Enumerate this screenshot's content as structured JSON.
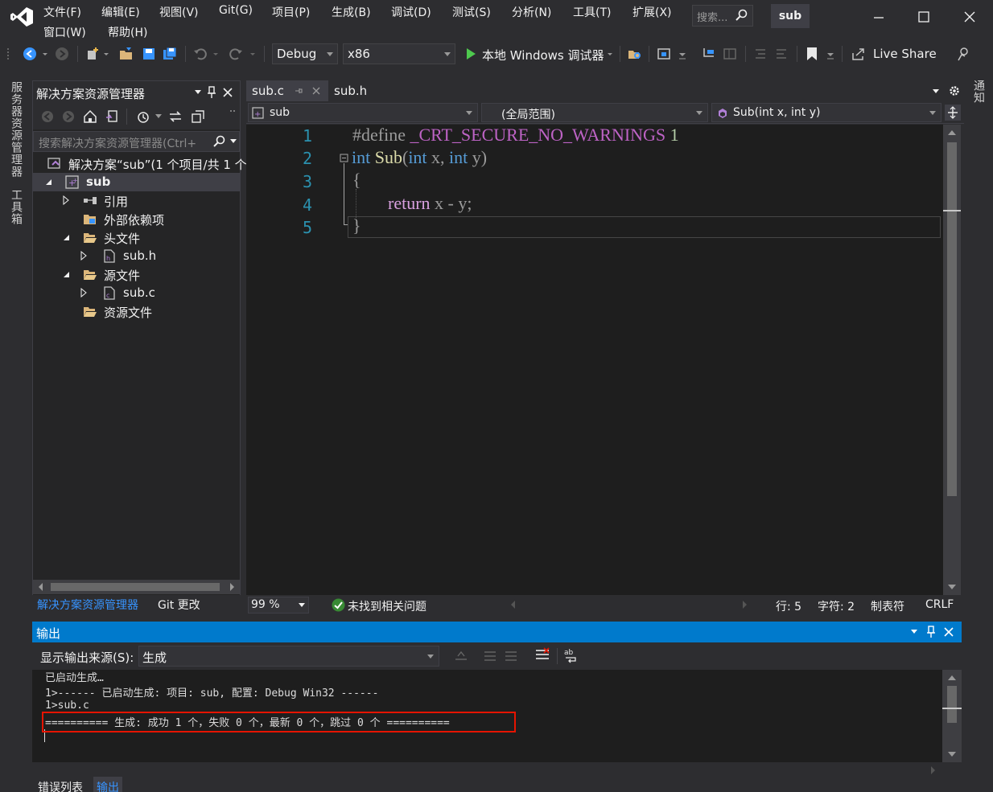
{
  "menu": {
    "items": [
      "文件(F)",
      "编辑(E)",
      "视图(V)",
      "Git(G)",
      "项目(P)",
      "生成(B)",
      "调试(D)",
      "测试(S)",
      "分析(N)",
      "工具(T)",
      "扩展(X)"
    ],
    "row2": [
      "窗口(W)",
      "帮助(H)"
    ],
    "search_placeholder": "搜索...",
    "solution_name": "sub"
  },
  "toolbar": {
    "config": "Debug",
    "platform": "x86",
    "run_label": "本地 Windows 调试器",
    "live_share": "Live Share"
  },
  "left_vtabs": [
    "服务器资源管理器",
    "工具箱"
  ],
  "right_vtab": "通知",
  "solution_explorer": {
    "title": "解决方案资源管理器",
    "search_placeholder": "搜索解决方案资源管理器(Ctrl+",
    "tree": [
      {
        "label": "解决方案“sub”(1 个项目/共 1 个",
        "level": 0
      },
      {
        "label": "sub",
        "level": 0
      },
      {
        "label": "引用",
        "level": 1
      },
      {
        "label": "外部依赖项",
        "level": 1
      },
      {
        "label": "头文件",
        "level": 1
      },
      {
        "label": "sub.h",
        "level": 2
      },
      {
        "label": "源文件",
        "level": 1
      },
      {
        "label": "sub.c",
        "level": 2
      },
      {
        "label": "资源文件",
        "level": 1
      }
    ],
    "tabs": [
      "解决方案资源管理器",
      "Git 更改"
    ]
  },
  "editor": {
    "tabs": [
      "sub.c",
      "sub.h"
    ],
    "nav": {
      "project": "sub",
      "scope": "(全局范围)",
      "member": "Sub(int x, int y)"
    },
    "line_numbers": [
      "1",
      "2",
      "3",
      "4",
      "5"
    ],
    "code": {
      "define_kw": "#define",
      "macro": "_CRT_SECURE_NO_WARNINGS",
      "one": "1",
      "int": "int",
      "fn": "Sub",
      "params_open": "(",
      "p_int1": "int",
      "p_x": " x, ",
      "p_int2": "int",
      "p_y": " y)",
      "lbrace": "{",
      "ret": "return",
      "expr": " x - y;",
      "rbrace": "}"
    },
    "status": {
      "zoom": "99 %",
      "issues": "未找到相关问题",
      "line": "行: 5",
      "char": "字符: 2",
      "tab": "制表符",
      "eol": "CRLF"
    }
  },
  "output": {
    "title": "输出",
    "source_label": "显示输出来源(S):",
    "source_value": "生成",
    "lines": [
      "已启动生成…",
      "1>------ 已启动生成: 项目: sub, 配置: Debug Win32 ------",
      "1>sub.c",
      "========== 生成: 成功 1 个，失败 0 个，最新 0 个，跳过 0 个 =========="
    ],
    "bottom_tabs": [
      "错误列表",
      "输出"
    ]
  },
  "colors": {
    "accent": "#007acc",
    "highlight_box": "#e51400"
  }
}
